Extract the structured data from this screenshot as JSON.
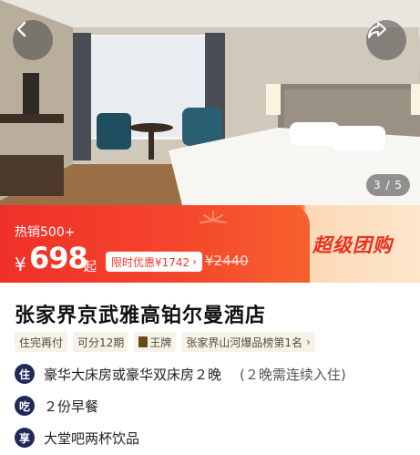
{
  "hero": {
    "photo_counter": "3 / 5",
    "back_icon": "chevron-left-icon",
    "share_icon": "share-arrow-icon"
  },
  "price": {
    "sold": "热销500+",
    "currency": "¥",
    "value": "698",
    "suffix": "起",
    "promo": "限时优惠¥1742",
    "promo_chevron": "›",
    "original": "¥2440",
    "campaign": "超级团购"
  },
  "hotel": {
    "title": "张家界京武雅高铂尔曼酒店",
    "tags": [
      "住完再付",
      "可分12期",
      "王牌",
      "张家界山河爆品榜第1名"
    ],
    "tag_chevron": "›"
  },
  "benefits": [
    {
      "badge": "住",
      "text": "豪华大床房或豪华双床房２晚",
      "note": "(２晚需连续入住)"
    },
    {
      "badge": "吃",
      "text": "２份早餐",
      "note": ""
    },
    {
      "badge": "享",
      "text": "大堂吧两杯饮品",
      "note": ""
    }
  ],
  "colors": {
    "banner_red": "#f23a2a",
    "banner_cream": "#fde6cc",
    "badge_navy": "#1f2a5a",
    "tag_bg": "#f5f2ea"
  }
}
